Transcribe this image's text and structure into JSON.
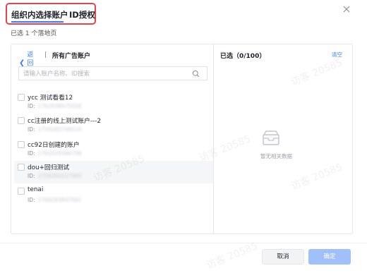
{
  "tabs": [
    {
      "label": "组织内选择账户",
      "active": true
    },
    {
      "label": "ID授权",
      "active": false
    }
  ],
  "selection_summary": "已选 1 个落地页",
  "left_panel": {
    "back_label": "返回",
    "title": "所有广告账户",
    "search_placeholder": "请输入账户名称、ID搜索",
    "id_prefix": "ID:",
    "accounts": [
      {
        "name": "ycc 测试看看12",
        "id": "1762938475016",
        "hover": false
      },
      {
        "name": "cc注册的线上测试账户---2",
        "id": "1759283746510",
        "hover": false
      },
      {
        "name": "cc92日创建的账户",
        "id": "1761029384756",
        "hover": false
      },
      {
        "name": "dou+回归测试",
        "id": "1758392017465",
        "hover": true
      },
      {
        "name": "tenai",
        "id": "1760293847561",
        "hover": false
      }
    ]
  },
  "right_panel": {
    "title": "已选（0/100）",
    "clear_label": "清空",
    "empty_text": "暂无相关数据"
  },
  "footer": {
    "cancel_label": "取消",
    "confirm_label": "确定"
  },
  "watermark": "访客 20585",
  "colors": {
    "accent": "#3b7cf6",
    "highlight_border": "#e8424a",
    "confirm_disabled": "#9fc0fa"
  },
  "icons": [
    "close-icon",
    "chevron-left-icon",
    "search-icon",
    "empty-inbox-icon"
  ]
}
